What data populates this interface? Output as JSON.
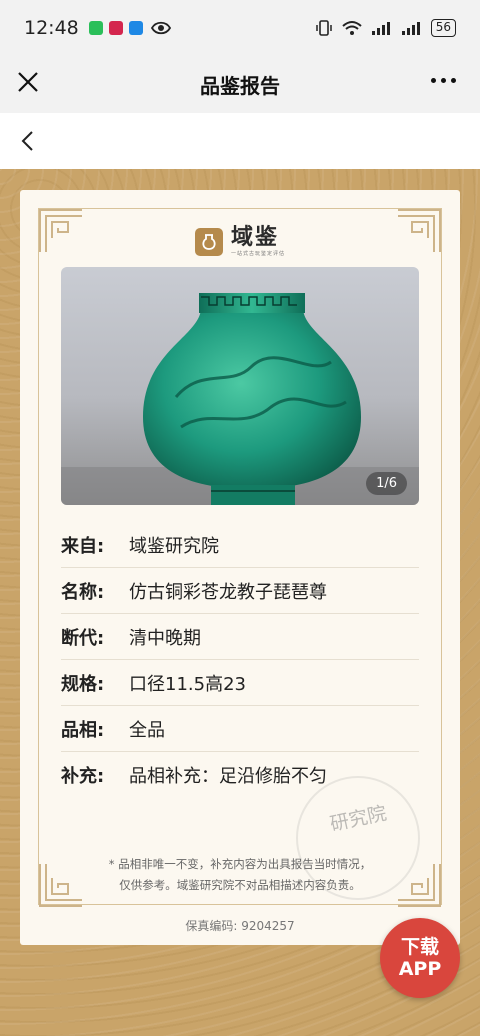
{
  "status_bar": {
    "time": "12:48",
    "battery": "56"
  },
  "nav": {
    "title": "品鉴报告"
  },
  "logo": {
    "name": "域鉴",
    "tagline": "一站式古玩鉴定评估"
  },
  "photo": {
    "counter": "1/6"
  },
  "info": {
    "rows": [
      {
        "label": "来自:",
        "value": "域鉴研究院"
      },
      {
        "label": "名称:",
        "value": "仿古铜彩苍龙教子琵琶尊"
      },
      {
        "label": "断代:",
        "value": "清中晚期"
      },
      {
        "label": "规格:",
        "value": "口径11.5高23"
      },
      {
        "label": "品相:",
        "value": "全品"
      },
      {
        "label": "补充:",
        "value": "品相补充：足沿修胎不匀"
      }
    ]
  },
  "disclaimer": {
    "line1": "* 品相非唯一不变，补充内容为出具报告当时情况，",
    "line2": "仅供参考。域鉴研究院不对品相描述内容负责。"
  },
  "code": {
    "text": "保真编码:  9204257"
  },
  "seal": {
    "text": "研究院"
  },
  "download": {
    "line1": "下载",
    "line2": "APP"
  },
  "colors": {
    "gold": "#c9a469",
    "card": "#fcf8f0",
    "jade": "#1d9a7e",
    "button": "#d9463d"
  }
}
